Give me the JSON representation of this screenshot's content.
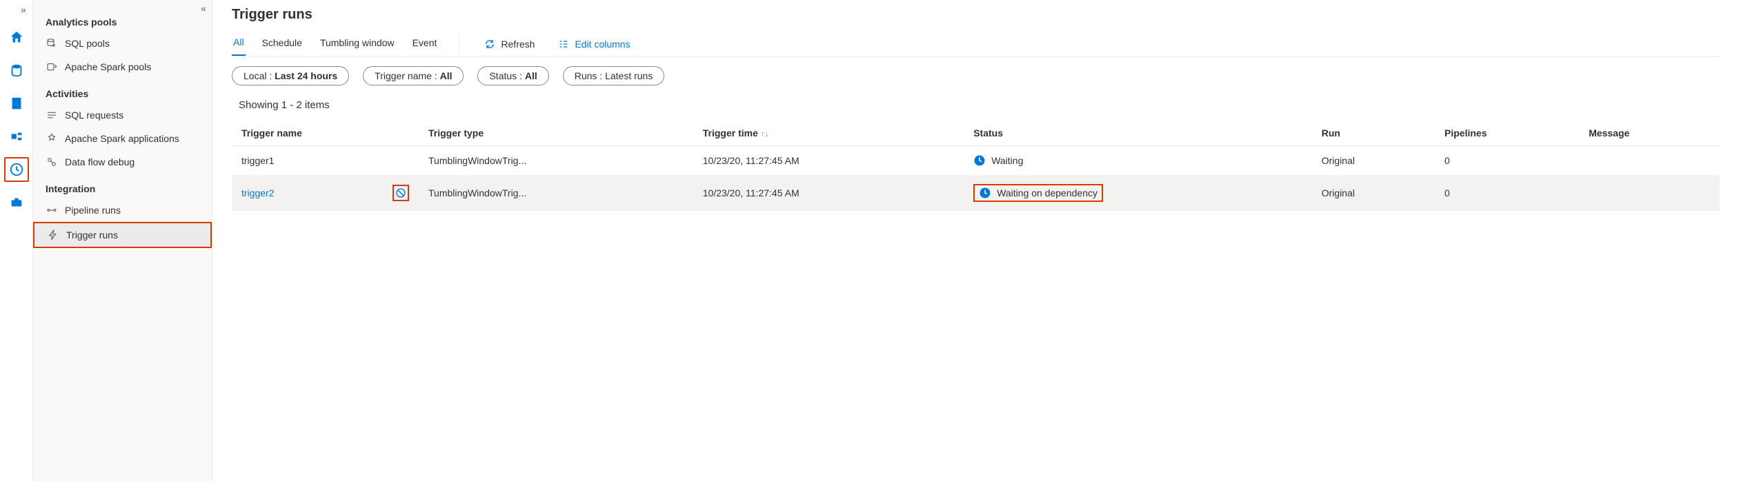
{
  "iconRail": {
    "expand": "»"
  },
  "sidePanel": {
    "collapse": "«",
    "sections": {
      "analytics_pools": "Analytics pools",
      "activities": "Activities",
      "integration": "Integration"
    },
    "sql_pools": "SQL pools",
    "spark_pools": "Apache Spark pools",
    "sql_requests": "SQL requests",
    "spark_apps": "Apache Spark applications",
    "data_flow_debug": "Data flow debug",
    "pipeline_runs": "Pipeline runs",
    "trigger_runs": "Trigger runs"
  },
  "page": {
    "title": "Trigger runs"
  },
  "tabs": {
    "all": "All",
    "schedule": "Schedule",
    "tumbling": "Tumbling window",
    "event": "Event"
  },
  "actions": {
    "refresh": "Refresh",
    "edit_columns": "Edit columns"
  },
  "filters": {
    "local_key": "Local : ",
    "local_val": "Last 24 hours",
    "trigger_key": "Trigger name : ",
    "trigger_val": "All",
    "status_key": "Status : ",
    "status_val": "All",
    "runs_key": "Runs : ",
    "runs_val": "Latest runs"
  },
  "count_line": "Showing 1 - 2 items",
  "columns": {
    "trigger_name": "Trigger name",
    "trigger_type": "Trigger type",
    "trigger_time": "Trigger time",
    "status": "Status",
    "run": "Run",
    "pipelines": "Pipelines",
    "message": "Message"
  },
  "rows": [
    {
      "name": "trigger1",
      "type": "TumblingWindowTrig...",
      "time": "10/23/20, 11:27:45 AM",
      "status": "Waiting",
      "run": "Original",
      "pipelines": "0",
      "message": ""
    },
    {
      "name": "trigger2",
      "type": "TumblingWindowTrig...",
      "time": "10/23/20, 11:27:45 AM",
      "status": "Waiting on dependency",
      "run": "Original",
      "pipelines": "0",
      "message": ""
    }
  ]
}
